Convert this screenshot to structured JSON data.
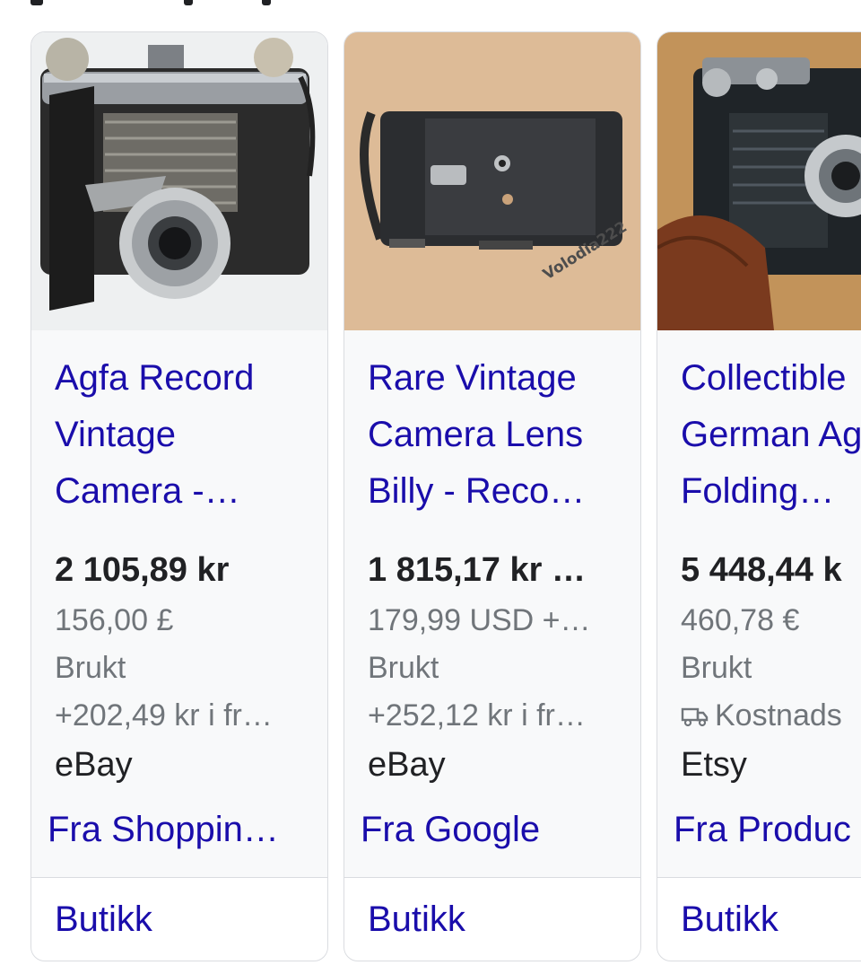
{
  "cards": [
    {
      "title_lines": [
        "Agfa Record",
        "Vintage",
        "Camera -…"
      ],
      "price": "2 105,89 kr",
      "original_price": "156,00 £",
      "condition": "Brukt",
      "shipping": "+202,49 kr i fr…",
      "shipping_icon": "",
      "store": "eBay",
      "source": "Fra Shoppin…",
      "button": "Butikk"
    },
    {
      "title_lines": [
        "Rare Vintage",
        "Camera Lens",
        "Billy - Reco…"
      ],
      "price": "1 815,17 kr …",
      "original_price": "179,99 USD +…",
      "condition": "Brukt",
      "shipping": "+252,12 kr i fr…",
      "shipping_icon": "",
      "store": "eBay",
      "source": "Fra Google",
      "button": "Butikk",
      "image_watermark": "Volodia222"
    },
    {
      "title_lines": [
        "Collectible",
        "German Ag",
        "Folding…"
      ],
      "price": "5 448,44 k",
      "original_price": "460,78 €",
      "condition": "Brukt",
      "shipping": "Kostnads",
      "shipping_icon": "truck-icon",
      "store": "Etsy",
      "source": "Fra Produc",
      "button": "Butikk"
    }
  ],
  "colors": {
    "link": "#1a0dab",
    "text": "#202124",
    "muted": "#70757a",
    "card_border": "#dadce0",
    "card_body": "#f8f9fa"
  }
}
